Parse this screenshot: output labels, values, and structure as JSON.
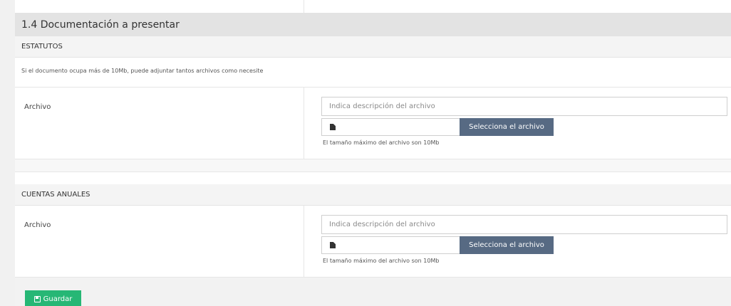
{
  "section": {
    "title": "1.4 Documentación a presentar"
  },
  "estatutos": {
    "header": "ESTATUTOS",
    "note": "Si el documento ocupa más de 10Mb, puede adjuntar tantos archivos como necesite",
    "label": "Archivo",
    "description_placeholder": "Indica descripción del archivo",
    "select_label": "Selecciona el archivo",
    "help": "El tamaño máximo del archivo son 10Mb"
  },
  "cuentas": {
    "header": "CUENTAS ANUALES",
    "label": "Archivo",
    "description_placeholder": "Indica descripción del archivo",
    "select_label": "Selecciona el archivo",
    "help": "El tamaño máximo del archivo son 10Mb"
  },
  "footer": {
    "save_label": "Guardar"
  },
  "icons": {
    "file": "file-icon",
    "save": "floppy-icon"
  },
  "colors": {
    "select_button": "#576a83",
    "save_button": "#26b775"
  }
}
